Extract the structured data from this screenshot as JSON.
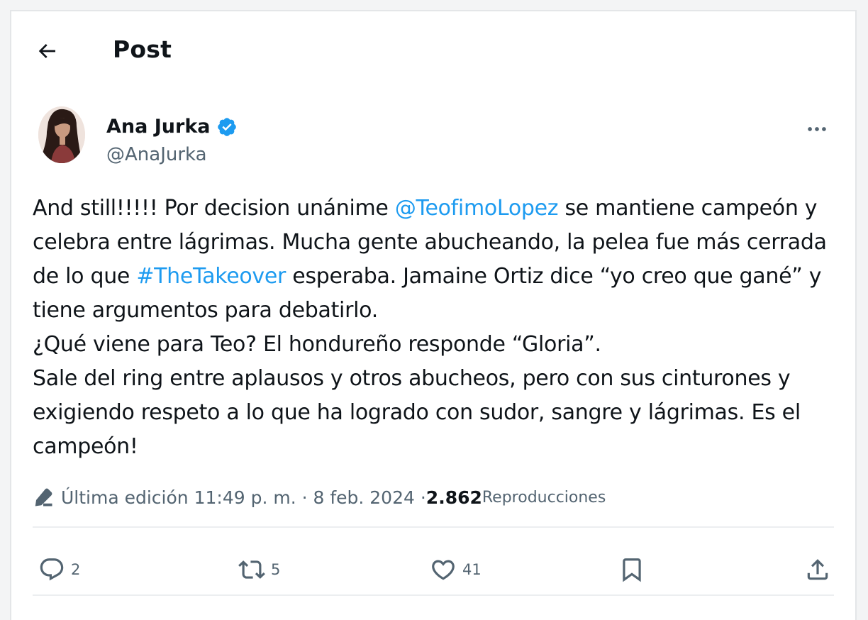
{
  "header": {
    "back_icon": "arrow-left-icon",
    "title": "Post"
  },
  "author": {
    "name": "Ana Jurka",
    "handle": "@AnaJurka",
    "verified": true,
    "verified_color": "#1d9bf0"
  },
  "post": {
    "segments": [
      {
        "text": "And still!!!!! Por decision unánime ",
        "type": "text"
      },
      {
        "text": "@TeofimoLopez",
        "type": "link"
      },
      {
        "text": " se mantiene campeón y celebra entre lágrimas. Mucha gente abucheando, la pelea fue más cerrada de lo que ",
        "type": "text"
      },
      {
        "text": "#TheTakeover",
        "type": "link"
      },
      {
        "text": " esperaba. Jamaine Ortiz dice “yo creo que gané” y tiene argumentos para debatirlo.",
        "type": "text"
      }
    ],
    "line2": "¿Qué viene para Teo? El hondureño responde “Gloria”.",
    "line3": "Sale del ring entre aplausos y otros abucheos, pero con sus cinturones y exigiendo respeto a lo que ha logrado con sudor, sangre y lágrimas. Es el campeón!",
    "link_color": "#1d9bf0"
  },
  "meta": {
    "edited_label": "Última edición 11:49 p. m. · 8 feb. 2024 · ",
    "views_count": "2.862",
    "views_label": " Reproducciones"
  },
  "actions": {
    "reply_count": "2",
    "repost_count": "5",
    "like_count": "41",
    "reply_icon": "reply-icon",
    "repost_icon": "repost-icon",
    "like_icon": "heart-icon",
    "bookmark_icon": "bookmark-icon",
    "share_icon": "share-icon"
  }
}
